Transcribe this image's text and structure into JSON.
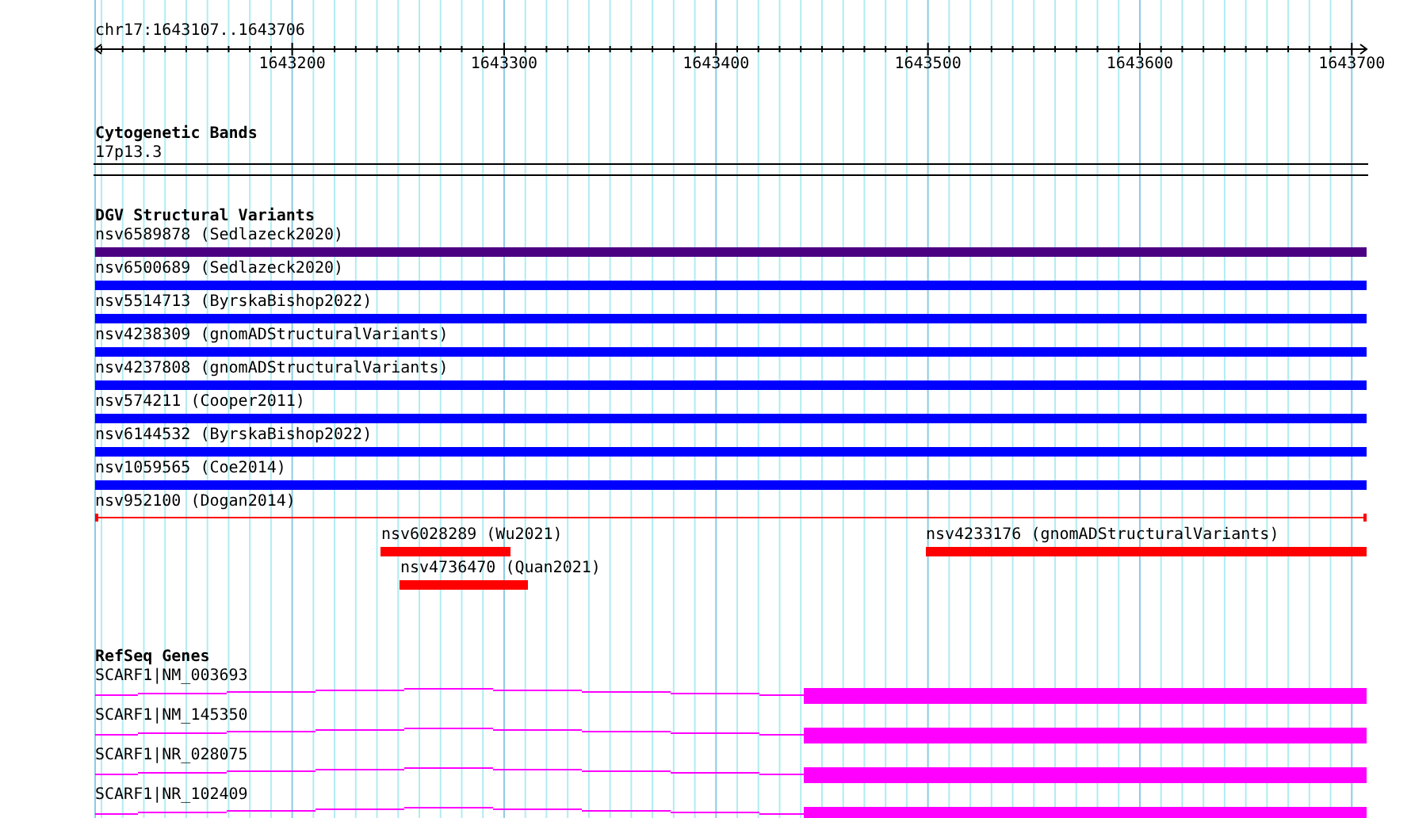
{
  "location": "chr17:1643107..1643706",
  "ruler": {
    "ticks": [
      "1643200",
      "1643300",
      "1643400",
      "1643500",
      "1643600",
      "1643700"
    ]
  },
  "cytobands": {
    "title": "Cytogenetic Bands",
    "features": [
      {
        "label": "17p13.3"
      }
    ]
  },
  "variants": {
    "title": "DGV Structural Variants",
    "features": [
      {
        "label": "nsv6589878 (Sedlazeck2020)",
        "kind": "bar",
        "color": "#4b0082"
      },
      {
        "label": "nsv6500689 (Sedlazeck2020)",
        "kind": "bar",
        "color": "#0000ff"
      },
      {
        "label": "nsv5514713 (ByrskaBishop2022)",
        "kind": "bar",
        "color": "#0000ff"
      },
      {
        "label": "nsv4238309 (gnomADStructuralVariants)",
        "kind": "bar",
        "color": "#0000ff"
      },
      {
        "label": "nsv4237808 (gnomADStructuralVariants)",
        "kind": "bar",
        "color": "#0000ff"
      },
      {
        "label": "nsv574211 (Cooper2011)",
        "kind": "bar",
        "color": "#0000ff"
      },
      {
        "label": "nsv6144532 (ByrskaBishop2022)",
        "kind": "bar",
        "color": "#0000ff"
      },
      {
        "label": "nsv1059565 (Coe2014)",
        "kind": "bar",
        "color": "#0000ff"
      },
      {
        "label": "nsv952100 (Dogan2014)",
        "kind": "line",
        "color": "#ff0000"
      },
      {
        "label": "nsv6028289 (Wu2021)",
        "kind": "bar",
        "color": "#ff0000"
      },
      {
        "label": "nsv4736470 (Quan2021)",
        "kind": "bar",
        "color": "#ff0000"
      },
      {
        "label": "nsv4233176 (gnomADStructuralVariants)",
        "kind": "bar",
        "color": "#ff0000"
      }
    ]
  },
  "genes": {
    "title": "RefSeq Genes",
    "features": [
      {
        "label": "SCARF1|NM_003693",
        "kind": "transcript"
      },
      {
        "label": "SCARF1|NM_145350",
        "kind": "transcript"
      },
      {
        "label": "SCARF1|NR_028075",
        "kind": "transcript"
      },
      {
        "label": "SCARF1|NR_102409",
        "kind": "transcript"
      }
    ]
  }
}
